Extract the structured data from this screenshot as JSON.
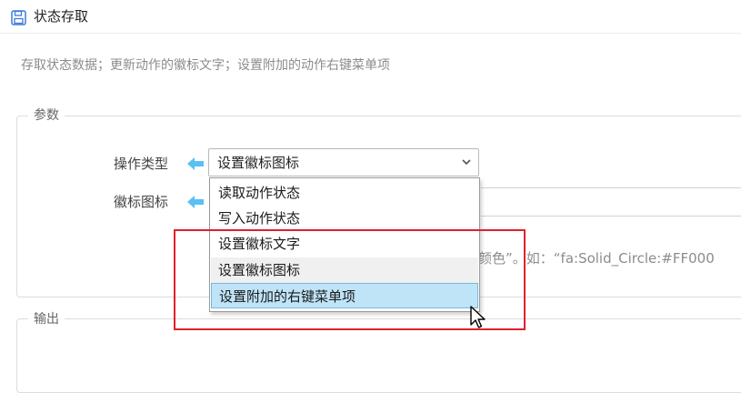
{
  "header": {
    "title": "状态存取",
    "icon": "save-icon",
    "description": "存取状态数据；更新动作的徽标文字；设置附加的动作右键菜单项"
  },
  "params": {
    "legend": "参数",
    "operation_type_label": "操作类型",
    "operation_type_value": "设置徽标图标",
    "badge_icon_label": "徽标图标",
    "badge_icon_value": "",
    "hint": "颜色”。如：“fa:Solid_Circle:#FF000"
  },
  "dropdown": {
    "options": [
      "读取动作状态",
      "写入动作状态",
      "设置徽标文字",
      "设置徽标图标",
      "设置附加的右键菜单项"
    ],
    "hovered": "设置附加的右键菜单项"
  },
  "output": {
    "legend": "输出"
  },
  "colors": {
    "arrow": "#5bc0f0",
    "highlight_box": "#e0202a",
    "hover_bg": "#bfe3f7"
  }
}
